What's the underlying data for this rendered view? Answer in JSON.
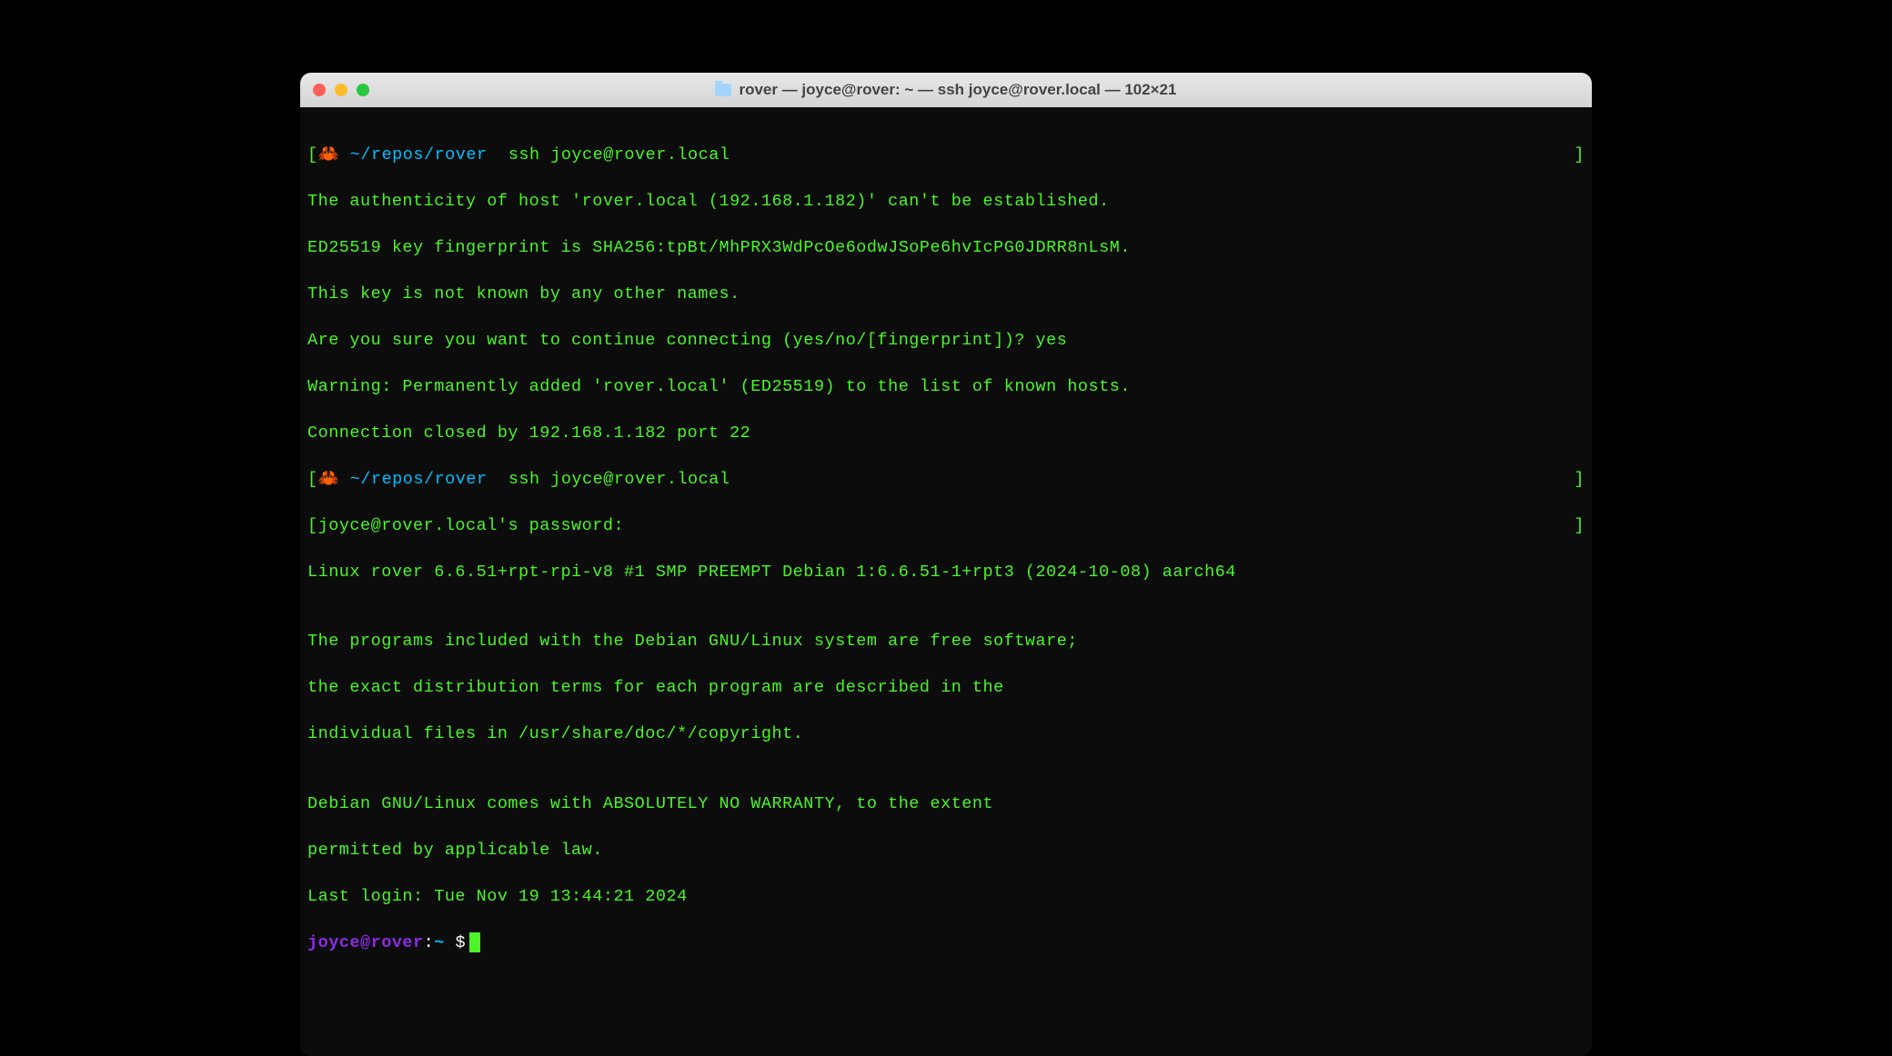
{
  "window": {
    "title": "rover — joyce@rover: ~ — ssh joyce@rover.local — 102×21"
  },
  "terminal": {
    "prompt1": {
      "crab": "🦀",
      "cwd": "~/repos/rover",
      "command": "ssh joyce@rover.local"
    },
    "output1": [
      "The authenticity of host 'rover.local (192.168.1.182)' can't be established.",
      "ED25519 key fingerprint is SHA256:tpBt/MhPRX3WdPcOe6odwJSoPe6hvIcPG0JDRR8nLsM.",
      "This key is not known by any other names.",
      "Are you sure you want to continue connecting (yes/no/[fingerprint])? yes",
      "Warning: Permanently added 'rover.local' (ED25519) to the list of known hosts.",
      "Connection closed by 192.168.1.182 port 22"
    ],
    "prompt2": {
      "crab": "🦀",
      "cwd": "~/repos/rover",
      "command": "ssh joyce@rover.local"
    },
    "output2": [
      "joyce@rover.local's password:",
      "Linux rover 6.6.51+rpt-rpi-v8 #1 SMP PREEMPT Debian 1:6.6.51-1+rpt3 (2024-10-08) aarch64",
      "",
      "The programs included with the Debian GNU/Linux system are free software;",
      "the exact distribution terms for each program are described in the",
      "individual files in /usr/share/doc/*/copyright.",
      "",
      "Debian GNU/Linux comes with ABSOLUTELY NO WARRANTY, to the extent",
      "permitted by applicable law.",
      "Last login: Tue Nov 19 13:44:21 2024"
    ],
    "remote_prompt": {
      "user": "joyce",
      "at": "@",
      "host": "rover",
      "colon": ":",
      "path": "~",
      "dollar": " $"
    },
    "brackets": {
      "left": "[",
      "right": "]"
    }
  }
}
